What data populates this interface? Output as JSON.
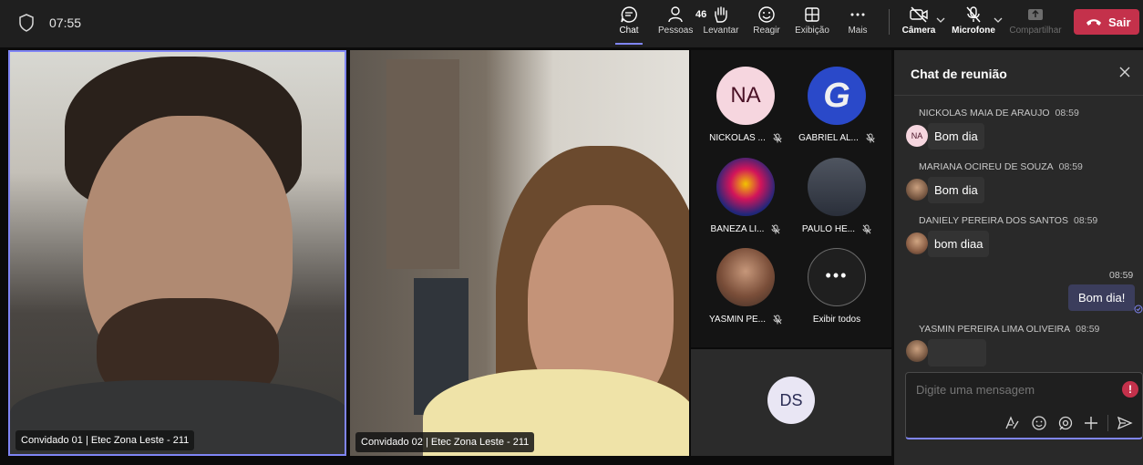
{
  "topbar": {
    "timer": "07:55",
    "buttons": [
      {
        "label": "Chat",
        "icon": "chat-icon"
      },
      {
        "label": "Pessoas",
        "icon": "people-icon",
        "count": "46"
      },
      {
        "label": "Levantar",
        "icon": "raise-hand-icon"
      },
      {
        "label": "Reagir",
        "icon": "smile-icon"
      },
      {
        "label": "Exibição",
        "icon": "grid-icon"
      },
      {
        "label": "Mais",
        "icon": "more-icon"
      },
      {
        "label": "Câmera",
        "icon": "camera-off-icon"
      },
      {
        "label": "Microfone",
        "icon": "mic-off-icon"
      },
      {
        "label": "Compartilhar",
        "icon": "share-icon"
      }
    ],
    "leave_label": "Sair",
    "colors": {
      "accent": "#7f85f5",
      "leave": "#c4314b"
    }
  },
  "stage": {
    "tiles": [
      {
        "name": "Convidado 01 | Etec Zona Leste - 211"
      },
      {
        "name": "Convidado 02 | Etec Zona Leste - 211"
      }
    ]
  },
  "gallery": {
    "people": [
      {
        "name": "NICKOLAS ...",
        "initials": "NA"
      },
      {
        "name": "GABRIEL AL...",
        "initials": "G"
      },
      {
        "name": "BANEZA LI..."
      },
      {
        "name": "PAULO HE..."
      },
      {
        "name": "YASMIN PE..."
      }
    ],
    "show_all_label": "Exibir todos",
    "self_initials": "DS"
  },
  "chat": {
    "title": "Chat de reunião",
    "messages": [
      {
        "sender": "NICKOLAS MAIA DE ARAUJO",
        "time": "08:59",
        "text": "Bom dia",
        "avatar": "NA"
      },
      {
        "sender": "MARIANA OCIREU DE SOUZA",
        "time": "08:59",
        "text": "Bom dia"
      },
      {
        "sender": "DANIELY PEREIRA DOS SANTOS",
        "time": "08:59",
        "text": "bom diaa"
      },
      {
        "sender": "YASMIN PEREIRA LIMA OLIVEIRA",
        "time": "08:59"
      }
    ],
    "my_message": {
      "time": "08:59",
      "text": "Bom dia!"
    },
    "compose_placeholder": "Digite uma mensagem",
    "alert": "!"
  }
}
